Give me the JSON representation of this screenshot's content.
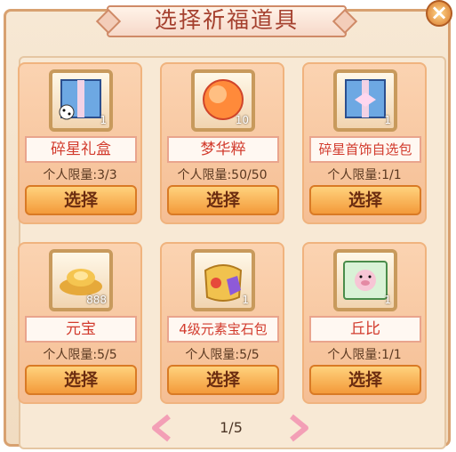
{
  "title": "选择祈福道具",
  "close_icon": "close-icon",
  "items": [
    {
      "name": "碎星礼盒",
      "qty": "1",
      "limit": "个人限量:3/3",
      "button": "选择",
      "icon": "gift-box-icon"
    },
    {
      "name": "梦华粹",
      "qty": "10",
      "limit": "个人限量:50/50",
      "button": "选择",
      "icon": "orb-icon"
    },
    {
      "name": "碎星首饰自选包",
      "qty": "1",
      "limit": "个人限量:1/1",
      "button": "选择",
      "icon": "gift-box-icon"
    },
    {
      "name": "元宝",
      "qty": "888",
      "limit": "个人限量:5/5",
      "button": "选择",
      "icon": "gold-ingot-icon"
    },
    {
      "name": "4级元素宝石包",
      "qty": "1",
      "limit": "个人限量:5/5",
      "button": "选择",
      "icon": "gem-bag-icon"
    },
    {
      "name": "丘比",
      "qty": "1",
      "limit": "个人限量:1/1",
      "button": "选择",
      "icon": "pig-scroll-icon"
    }
  ],
  "pager": {
    "text": "1/5"
  }
}
